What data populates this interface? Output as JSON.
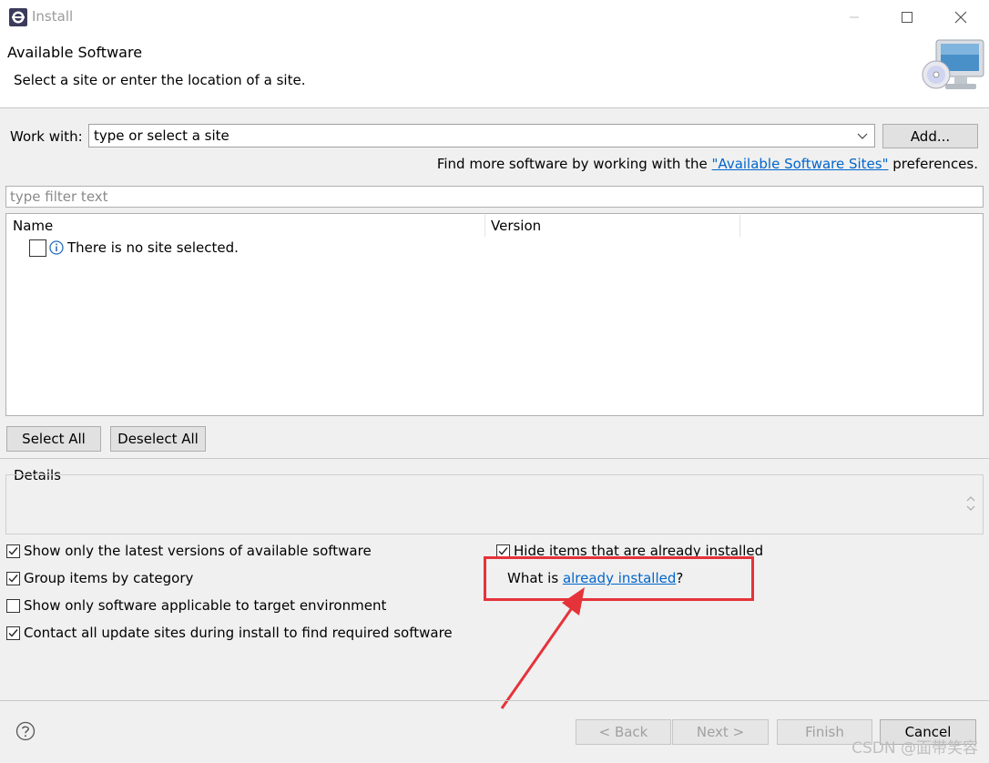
{
  "window": {
    "title": "Install"
  },
  "header": {
    "title": "Available Software",
    "subtitle": "Select a site or enter the location of a site."
  },
  "work_with": {
    "label": "Work with:",
    "value": "type or select a site",
    "add_button": "Add...",
    "more_text": "Find more software by working with the ",
    "more_link": "\"Available Software Sites\"",
    "more_suffix": " preferences."
  },
  "filter": {
    "placeholder": "type filter text"
  },
  "table": {
    "columns": [
      "Name",
      "Version"
    ],
    "rows": [
      {
        "name": "There is no site selected."
      }
    ]
  },
  "selection": {
    "select_all": "Select All",
    "deselect_all": "Deselect All"
  },
  "details": {
    "label": "Details"
  },
  "options": {
    "left": [
      {
        "label": "Show only the latest versions of available software",
        "checked": true
      },
      {
        "label": "Group items by category",
        "checked": true
      },
      {
        "label": "Show only software applicable to target environment",
        "checked": false
      },
      {
        "label": "Contact all update sites during install to find required software",
        "checked": true
      }
    ],
    "right": {
      "label": "Hide items that are already installed",
      "checked": true
    },
    "what_is_prefix": "What is ",
    "what_is_link": "already installed",
    "what_is_suffix": "?"
  },
  "footer": {
    "back": "< Back",
    "next": "Next >",
    "finish": "Finish",
    "cancel": "Cancel"
  },
  "watermark": "CSDN @面带笑容",
  "colors": {
    "link": "#0066cc",
    "highlight": "#e5333a"
  }
}
